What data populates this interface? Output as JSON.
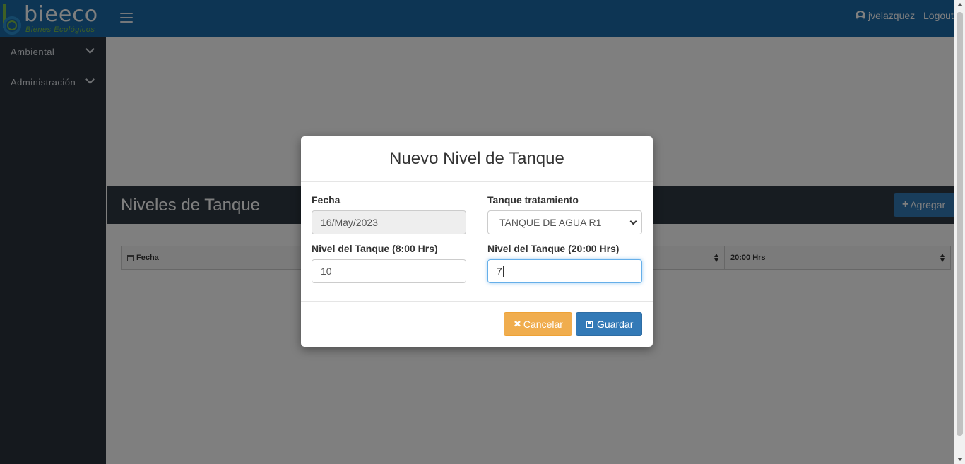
{
  "header": {
    "logo_text": "bieeco",
    "logo_subtitle": "Bienes Ecológicos",
    "user_name": "jvelazquez",
    "logout_label": "Logout"
  },
  "sidebar": {
    "items": [
      {
        "label": "Ambiental"
      },
      {
        "label": "Administración"
      }
    ]
  },
  "page": {
    "title": "Niveles de Tanque",
    "add_label": "Agregar",
    "table": {
      "columns": [
        "Fecha",
        "20:00 Hrs"
      ]
    }
  },
  "modal": {
    "title": "Nuevo Nivel de Tanque",
    "fecha_label": "Fecha",
    "fecha_value": "16/May/2023",
    "tanque_label": "Tanque tratamiento",
    "tanque_value": "TANQUE DE AGUA R1",
    "nivel8_label": "Nivel del Tanque (8:00 Hrs)",
    "nivel8_value": "10",
    "nivel20_label": "Nivel del Tanque (20:00 Hrs)",
    "nivel20_value": "7",
    "cancel_label": "Cancelar",
    "save_label": "Guardar"
  },
  "colors": {
    "navbar": "#1b6aa8",
    "sidebar": "#2b333d",
    "cancel": "#f0ad4e",
    "primary": "#337ab7"
  }
}
